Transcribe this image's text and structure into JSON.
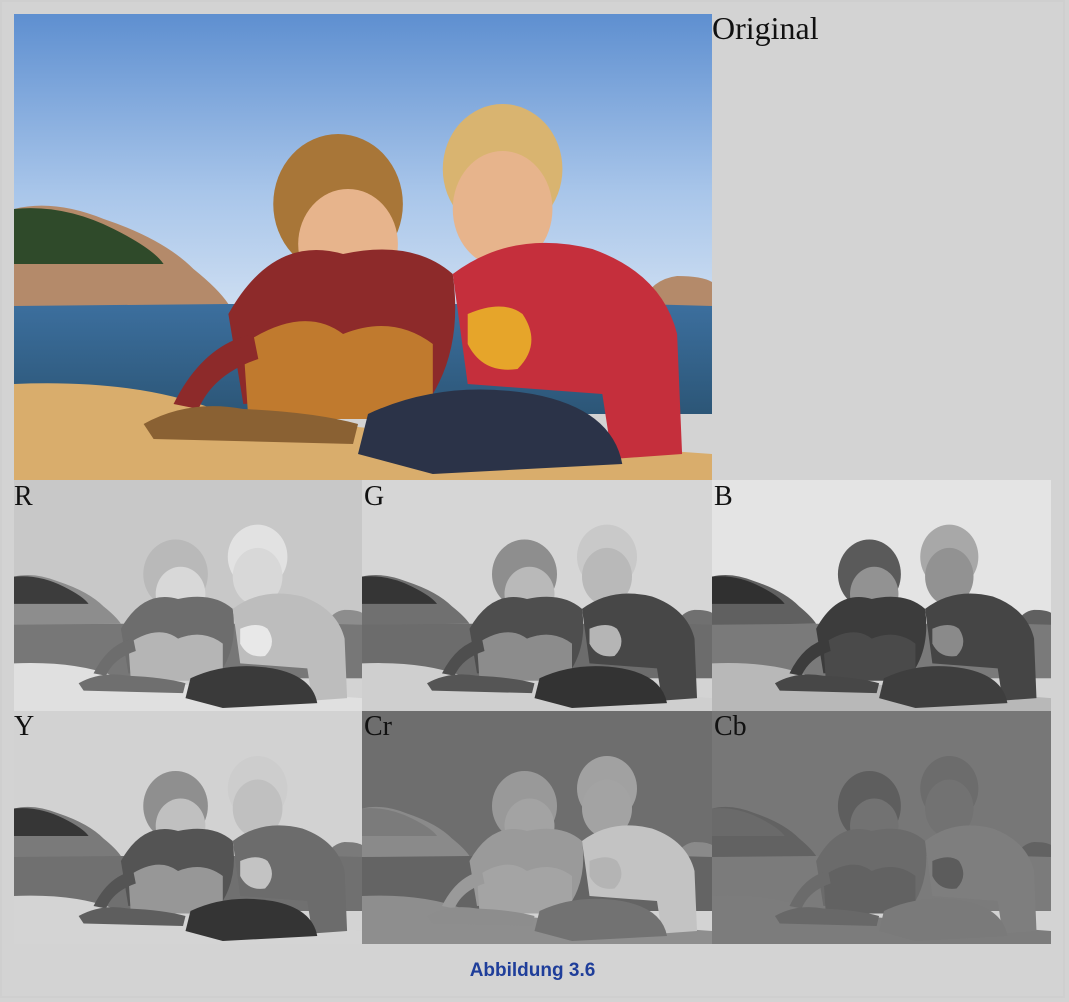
{
  "labels": {
    "original": "Original",
    "r": "R",
    "g": "G",
    "b": "B",
    "y": "Y",
    "cr": "Cr",
    "cb": "Cb"
  },
  "caption": "Abbildung 3.6",
  "colors": {
    "background": "#d3d3d3",
    "caption": "#1f3e9a"
  }
}
